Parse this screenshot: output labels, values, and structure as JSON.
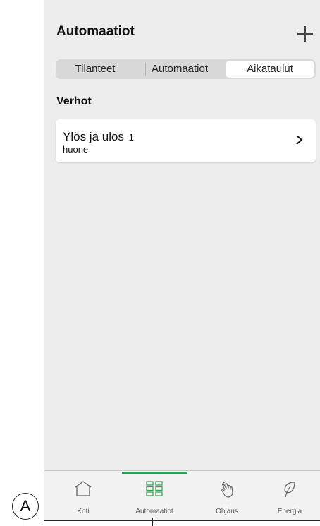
{
  "header": {
    "title": "Automaatiot",
    "add_icon": "plus-icon"
  },
  "segmented": {
    "items": [
      "Tilanteet",
      "Automaatiot",
      "Aikataulut"
    ],
    "selected": "Aikataulut"
  },
  "section": {
    "title": "Verhot"
  },
  "card": {
    "title": "Ylös ja ulos",
    "count": "1",
    "subtitle": "huone",
    "icon": "chevron-right-icon"
  },
  "tabbar": {
    "items": [
      {
        "label": "Koti",
        "icon": "home-icon"
      },
      {
        "label": "Automaatiot",
        "icon": "grid-icon"
      },
      {
        "label": "Ohjaus",
        "icon": "hand-touch-icon"
      },
      {
        "label": "Energia",
        "icon": "leaf-icon"
      }
    ],
    "active": "Automaatiot",
    "accent_color": "#2f9e4e"
  },
  "annotation": {
    "label": "A"
  }
}
